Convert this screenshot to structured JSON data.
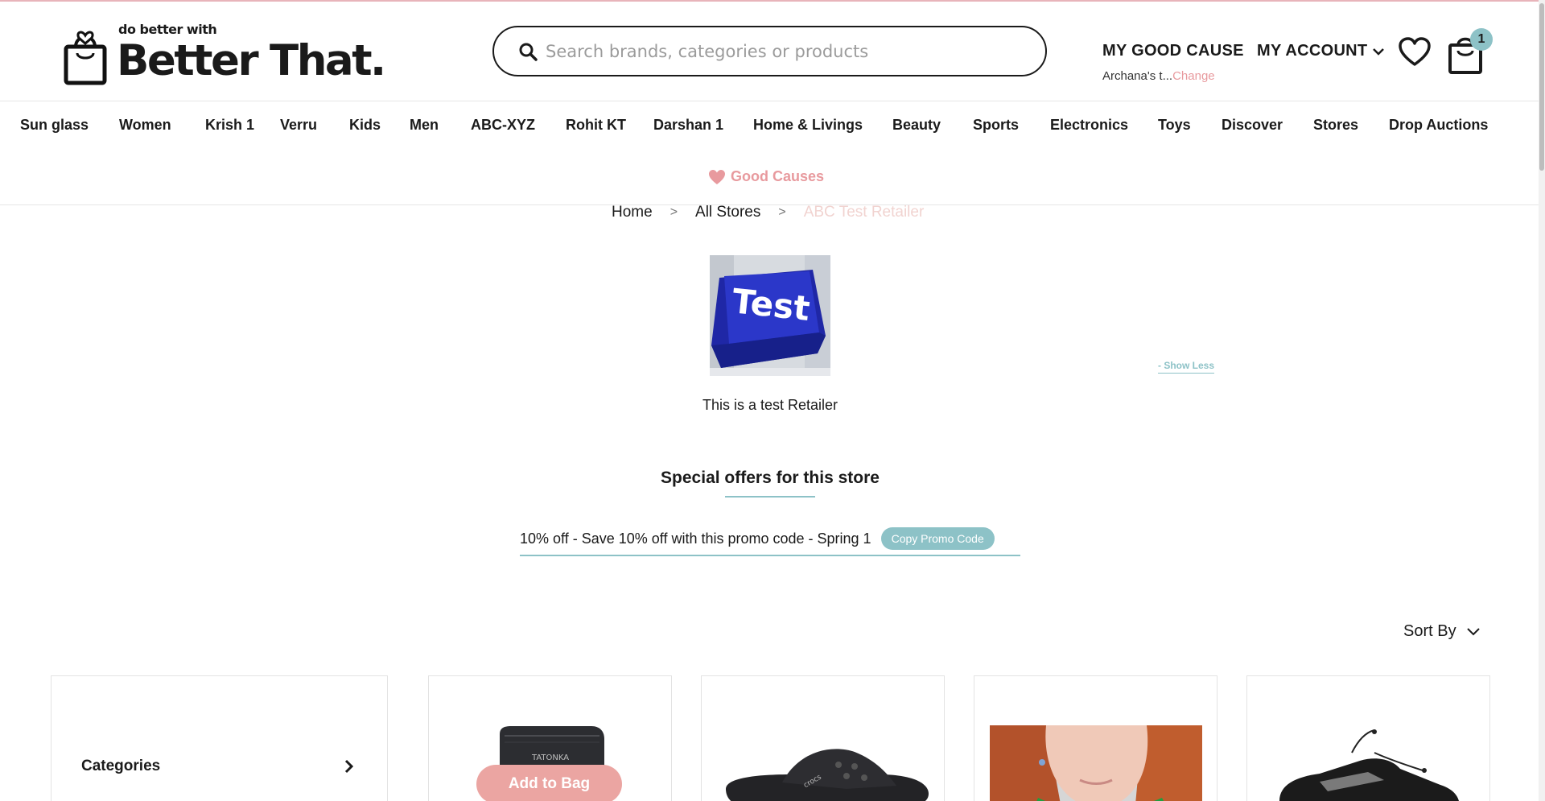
{
  "header": {
    "logo_small": "do better with",
    "logo_big": "Better That.",
    "search_placeholder": "Search brands, categories or products",
    "good_cause_label": "MY GOOD CAUSE",
    "cause_name": "Archana's t...",
    "cause_change": "Change",
    "account_label": "MY ACCOUNT",
    "cart_count": "1"
  },
  "nav": {
    "items": [
      "Sun glass",
      "Women",
      "Krish 1",
      "Verru",
      "Kids",
      "Men",
      "ABC-XYZ",
      "Rohit KT",
      "Darshan 1",
      "Home & Livings",
      "Beauty",
      "Sports",
      "Electronics",
      "Toys",
      "Discover",
      "Stores",
      "Drop Auctions"
    ],
    "good_causes": "Good Causes"
  },
  "breadcrumb": {
    "home": "Home",
    "all_stores": "All Stores",
    "current": "ABC Test Retailer",
    "separator": ">"
  },
  "store": {
    "logo_text": "Test",
    "show_less": "- Show Less",
    "description": "This is a test Retailer",
    "offers_title": "Special offers for this store",
    "promo_text": "10% off - Save 10% off with this promo code - Spring 1",
    "copy_promo_label": "Copy Promo Code"
  },
  "listing": {
    "sort_label": "Sort By",
    "categories_label": "Categories",
    "add_to_bag_label": "Add to Bag",
    "product_1_brand": "TATONKA",
    "product_2_brand": "crocs"
  },
  "colors": {
    "accent_teal": "#8dc2c7",
    "accent_pink": "#e89a9e",
    "add_to_bag_bg": "#eba5a2",
    "store_logo_blue": "#2b37c9"
  }
}
